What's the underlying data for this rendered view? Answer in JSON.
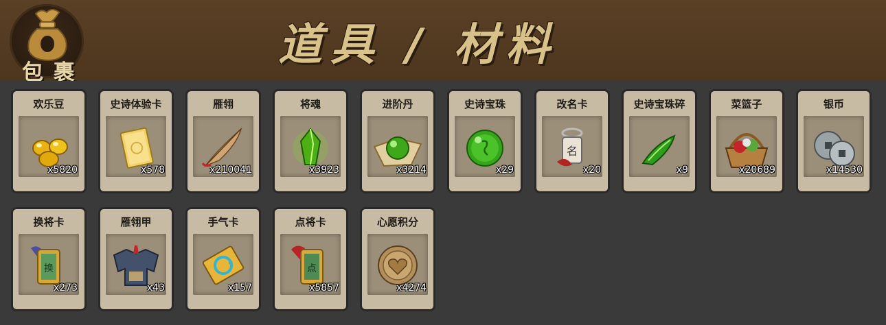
{
  "header": {
    "bag_label": "包 裹",
    "title": "道具 / 材料"
  },
  "items": [
    {
      "name": "欢乐豆",
      "count": "x5820",
      "icon": "golden-beans-icon"
    },
    {
      "name": "史诗体验卡",
      "count": "x578",
      "icon": "gold-card-icon"
    },
    {
      "name": "雁翎",
      "count": "x210041",
      "icon": "feather-icon"
    },
    {
      "name": "将魂",
      "count": "x3923",
      "icon": "green-crystal-icon"
    },
    {
      "name": "进阶丹",
      "count": "x3214",
      "icon": "green-orb-on-cloth-icon"
    },
    {
      "name": "史诗宝珠",
      "count": "x29",
      "icon": "green-pearl-icon"
    },
    {
      "name": "改名卡",
      "count": "x20",
      "icon": "rename-card-icon"
    },
    {
      "name": "史诗宝珠碎",
      "count": "x9",
      "icon": "green-shard-icon"
    },
    {
      "name": "菜篮子",
      "count": "x20689",
      "icon": "vegetable-basket-icon"
    },
    {
      "name": "银币",
      "count": "x14530",
      "icon": "silver-coin-icon"
    },
    {
      "name": "换将卡",
      "count": "x273",
      "icon": "swap-general-card-icon"
    },
    {
      "name": "雁翎甲",
      "count": "x43",
      "icon": "armor-icon"
    },
    {
      "name": "手气卡",
      "count": "x157",
      "icon": "luck-card-icon"
    },
    {
      "name": "点将卡",
      "count": "x5857",
      "icon": "select-general-card-icon"
    },
    {
      "name": "心愿积分",
      "count": "x4274",
      "icon": "heart-coin-icon"
    }
  ],
  "colors": {
    "header_bg": "#51391f",
    "page_bg": "#3a3a3a",
    "card_bg": "#c7bba4",
    "title_color": "#d9c18a"
  }
}
